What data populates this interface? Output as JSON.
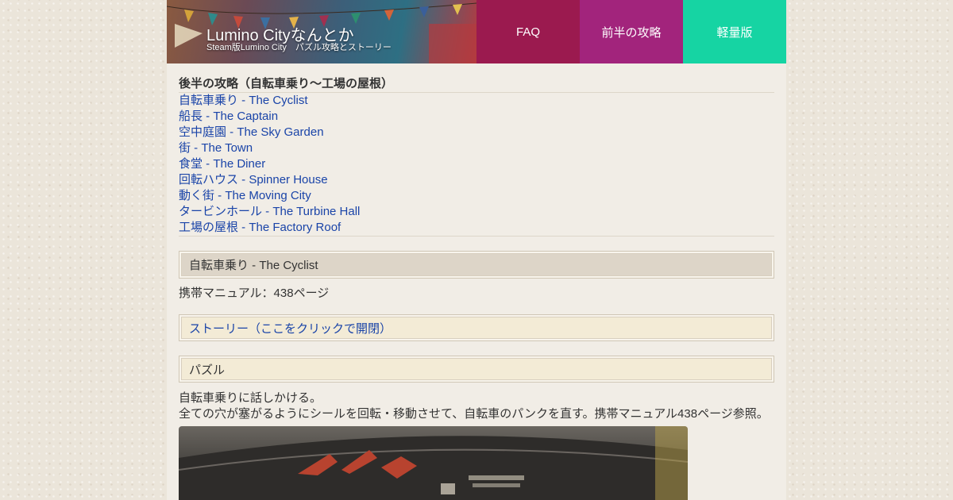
{
  "header": {
    "title": "Lumino Cityなんとか",
    "subtitle": "Steam版Lumino City　パズル攻略とストーリー"
  },
  "nav": [
    {
      "label": "FAQ",
      "color": "#9b1a4f"
    },
    {
      "label": "前半の攻略",
      "color": "#a2247c"
    },
    {
      "label": "軽量版",
      "color": "#16d4a3"
    }
  ],
  "section": {
    "title": "後半の攻略（自転車乗り～工場の屋根）",
    "links": [
      "自転車乗り - The Cyclist",
      "船長 - The Captain",
      "空中庭園 - The Sky Garden",
      "街 - The Town",
      "食堂 - The Diner",
      "回転ハウス - Spinner House",
      "動く街 - The Moving City",
      "タービンホール - The Turbine Hall",
      "工場の屋根 - The Factory Roof"
    ]
  },
  "chapter": {
    "heading": "自転車乗り - The Cyclist",
    "manual": "携帯マニュアル：438ページ",
    "story_toggle": "ストーリー（ここをクリックで開閉）",
    "puzzle_heading": "パズル",
    "desc_line1": "自転車乗りに話しかける。",
    "desc_line2": "全ての穴が塞がるようにシールを回転・移動させて、自転車のパンクを直す。携帯マニュアル438ページ参照。"
  },
  "colors": {
    "link": "#1a44a8",
    "nav_faq": "#9b1a4f",
    "nav_first": "#a2247c",
    "nav_lite": "#16d4a3"
  }
}
